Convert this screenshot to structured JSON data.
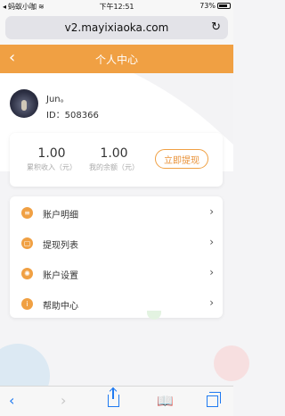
{
  "status_bar": {
    "carrier": "蚂蚁小咖",
    "time": "下午12:51",
    "battery": "73%"
  },
  "browser": {
    "url": "v2.mayixiaoka.com"
  },
  "header": {
    "title": "个人中心"
  },
  "profile": {
    "username": "Jun。",
    "user_id": "ID：508366"
  },
  "stats": {
    "total_income_value": "1.00",
    "total_income_label": "累积收入（元）",
    "balance_value": "1.00",
    "balance_label": "我的余额（元）",
    "withdraw_button": "立即提现"
  },
  "menu": {
    "items": [
      {
        "label": "账户明细"
      },
      {
        "label": "提现列表"
      },
      {
        "label": "账户设置"
      },
      {
        "label": "帮助中心"
      }
    ]
  },
  "colors": {
    "accent": "#f0a043",
    "ios_blue": "#1f7af1"
  }
}
